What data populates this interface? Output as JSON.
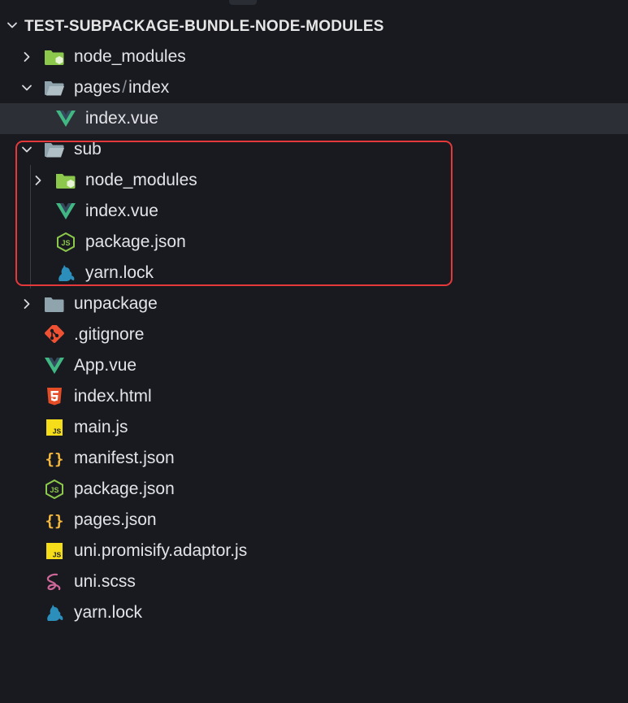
{
  "explorer": {
    "root_title": "TEST-SUBPACKAGE-BUNDLE-NODE-MODULES"
  },
  "tree": [
    {
      "id": "node_modules",
      "label": "node_modules",
      "icon": "node-folder-icon",
      "chevron": "right"
    },
    {
      "id": "pages",
      "label_parts": [
        "pages",
        "/",
        "index"
      ],
      "icon": "open-folder-icon",
      "chevron": "down"
    },
    {
      "id": "pages-index-vue",
      "label": "index.vue",
      "icon": "vue-icon",
      "selected": true
    },
    {
      "id": "sub",
      "label": "sub",
      "icon": "open-folder-icon",
      "chevron": "down"
    },
    {
      "id": "sub-node_modules",
      "label": "node_modules",
      "icon": "node-folder-icon",
      "chevron": "right"
    },
    {
      "id": "sub-index-vue",
      "label": "index.vue",
      "icon": "vue-icon"
    },
    {
      "id": "sub-package-json",
      "label": "package.json",
      "icon": "nodejs-icon"
    },
    {
      "id": "sub-yarn-lock",
      "label": "yarn.lock",
      "icon": "yarn-icon"
    },
    {
      "id": "unpackage",
      "label": "unpackage",
      "icon": "folder-icon",
      "chevron": "right"
    },
    {
      "id": "gitignore",
      "label": ".gitignore",
      "icon": "git-icon"
    },
    {
      "id": "app-vue",
      "label": "App.vue",
      "icon": "vue-icon"
    },
    {
      "id": "index-html",
      "label": "index.html",
      "icon": "html5-icon"
    },
    {
      "id": "main-js",
      "label": "main.js",
      "icon": "js-icon"
    },
    {
      "id": "manifest-json",
      "label": "manifest.json",
      "icon": "json-braces-icon"
    },
    {
      "id": "package-json",
      "label": "package.json",
      "icon": "nodejs-icon"
    },
    {
      "id": "pages-json",
      "label": "pages.json",
      "icon": "json-braces-icon"
    },
    {
      "id": "uni-promisify",
      "label": "uni.promisify.adaptor.js",
      "icon": "js-icon"
    },
    {
      "id": "uni-scss",
      "label": "uni.scss",
      "icon": "sass-icon"
    },
    {
      "id": "yarn-lock",
      "label": "yarn.lock",
      "icon": "yarn-icon"
    }
  ],
  "colors": {
    "background": "#181a1f",
    "selected_row": "#2c2f35",
    "highlight_border": "#e5383b",
    "vue_green": "#41b883",
    "node_green": "#8cc84b",
    "folder_gray": "#90a4ae",
    "git_orange": "#f05133",
    "html_orange": "#e44d26",
    "js_yellow": "#f5de19",
    "json_yellow": "#f5b83d",
    "sass_pink": "#cd6799",
    "yarn_blue": "#2c8ebb"
  }
}
